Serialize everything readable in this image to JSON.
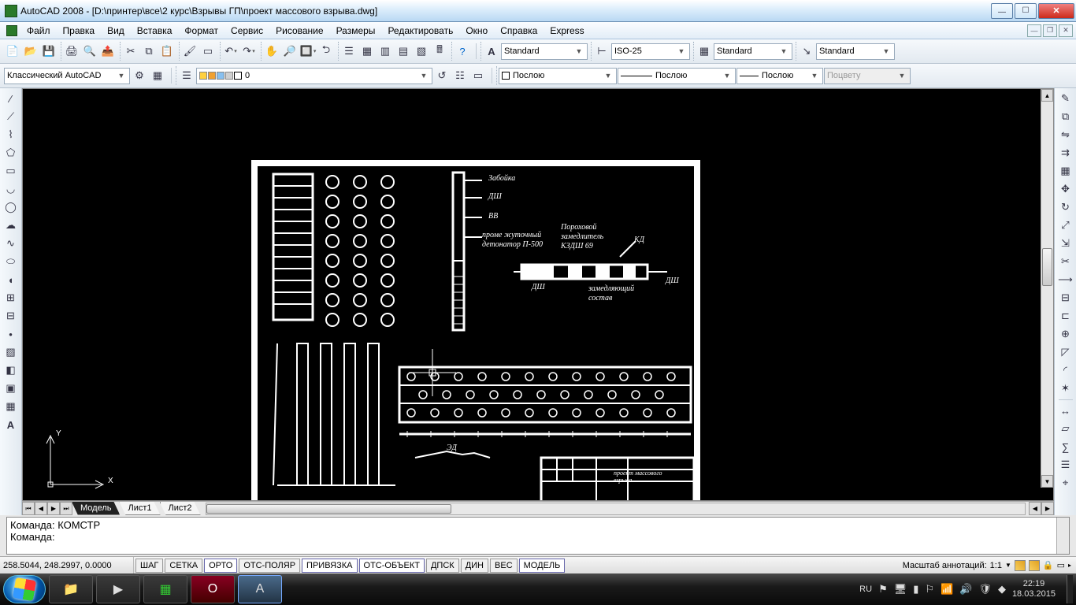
{
  "title": "AutoCAD 2008 - [D:\\принтер\\все\\2 курс\\Взрывы ГП\\проект массового взрыва.dwg]",
  "menu": [
    "Файл",
    "Правка",
    "Вид",
    "Вставка",
    "Формат",
    "Сервис",
    "Рисование",
    "Размеры",
    "Редактировать",
    "Окно",
    "Справка",
    "Express"
  ],
  "combos": {
    "workspace": "Классический AutoCAD",
    "layer": "0",
    "textstyle": "Standard",
    "dimstyle": "ISO-25",
    "tablestyle": "Standard",
    "mleader": "Standard",
    "color": "Послою",
    "ltype": "Послою",
    "lweight": "Послою",
    "plotstyle": "Поцвету"
  },
  "tabs": {
    "active": "Модель",
    "others": [
      "Лист1",
      "Лист2"
    ]
  },
  "cmd": {
    "line1": "Команда: КОМСТР",
    "line2": "Команда:"
  },
  "status": {
    "coords": "258.5044, 248.2997, 0.0000",
    "toggles": [
      "ШАГ",
      "СЕТКА",
      "ОРТО",
      "ОТС-ПОЛЯР",
      "ПРИВЯЗКА",
      "ОТС-ОБЪЕКТ",
      "ДПСК",
      "ДИН",
      "ВЕС",
      "МОДЕЛЬ"
    ],
    "toggles_on": [
      2,
      4,
      5,
      9
    ],
    "ann_label": "Масштаб аннотаций:",
    "ann_scale": "1:1"
  },
  "tray": {
    "lang": "RU",
    "time": "22:19",
    "date": "18.03.2015"
  },
  "drawing": {
    "labels": {
      "zaboika": "Забойка",
      "dsh": "ДШ",
      "vv": "ВВ",
      "prom": "проме жуточный",
      "det": "детонатор П-500",
      "por1": "Пороховой",
      "por2": "замедлитель",
      "por3": "КЗДШ 69",
      "kd": "КД",
      "dsh2": "ДШ",
      "dsh3": "ДШ",
      "zam1": "замедляющий",
      "zam2": "состав",
      "ed": "ЭД",
      "ttl1": "проект массового",
      "ttl2": "взрыва"
    },
    "ucs": {
      "y": "Y",
      "x": "X"
    }
  }
}
